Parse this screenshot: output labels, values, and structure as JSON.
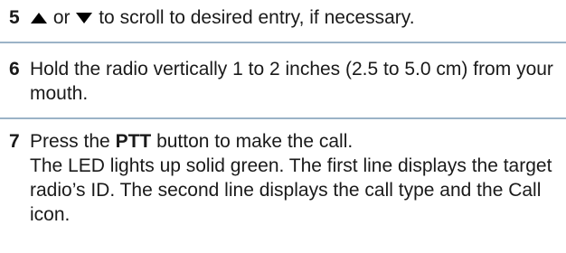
{
  "steps": [
    {
      "number": "5",
      "up_icon": "triangle-up-icon",
      "connector": "or",
      "down_icon": "triangle-down-icon",
      "text": "to scroll to desired entry, if necessary."
    },
    {
      "number": "6",
      "text": "Hold the radio vertically 1 to 2 inches (2.5 to 5.0 cm) from your mouth."
    },
    {
      "number": "7",
      "text_before": "Press the",
      "bold": "PTT",
      "text_after": "button to make the call.",
      "result": "The LED lights up solid green. The first line displays the target radio’s ID. The second line displays the call type and the Call icon."
    }
  ],
  "rule_color": "#9bb3c7"
}
